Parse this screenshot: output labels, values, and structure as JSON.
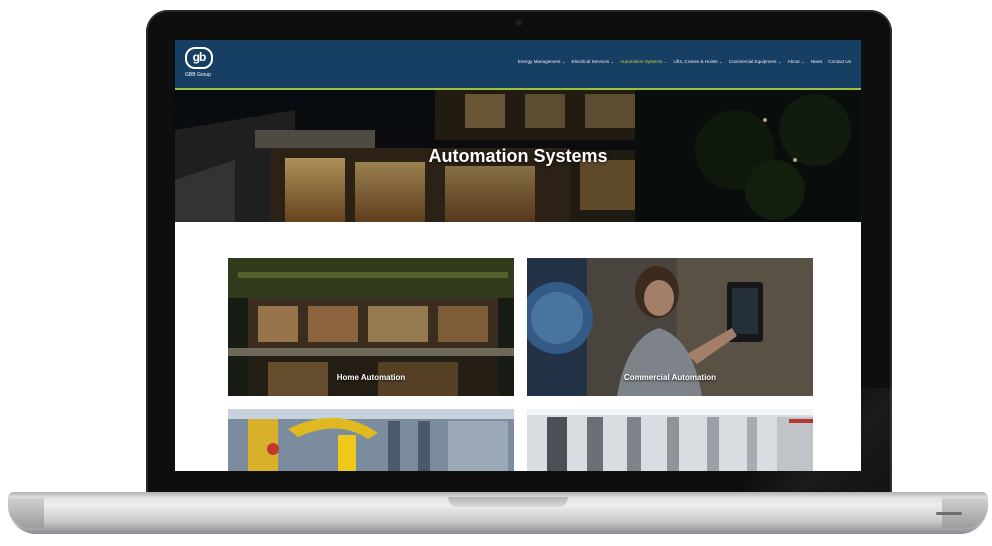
{
  "site": {
    "logo_mark": "gb",
    "logo_name": "GBB Group"
  },
  "nav": {
    "items": [
      {
        "label": "Energy Management ⌄"
      },
      {
        "label": "Electrical Services ⌄"
      },
      {
        "label": "Automation Systems ⌄"
      },
      {
        "label": "Lifts, Cranes & Hoists ⌄"
      },
      {
        "label": "Commercial Equipment ⌄"
      },
      {
        "label": "About ⌄"
      },
      {
        "label": "News"
      },
      {
        "label": "Contact Us"
      }
    ],
    "active_index": 2
  },
  "hero": {
    "title": "Automation Systems"
  },
  "cards": [
    {
      "label": "Home Automation"
    },
    {
      "label": "Commercial Automation"
    },
    {
      "label": ""
    },
    {
      "label": ""
    }
  ],
  "colors": {
    "nav_bg": "#173e63",
    "accent": "#9ec13a"
  }
}
